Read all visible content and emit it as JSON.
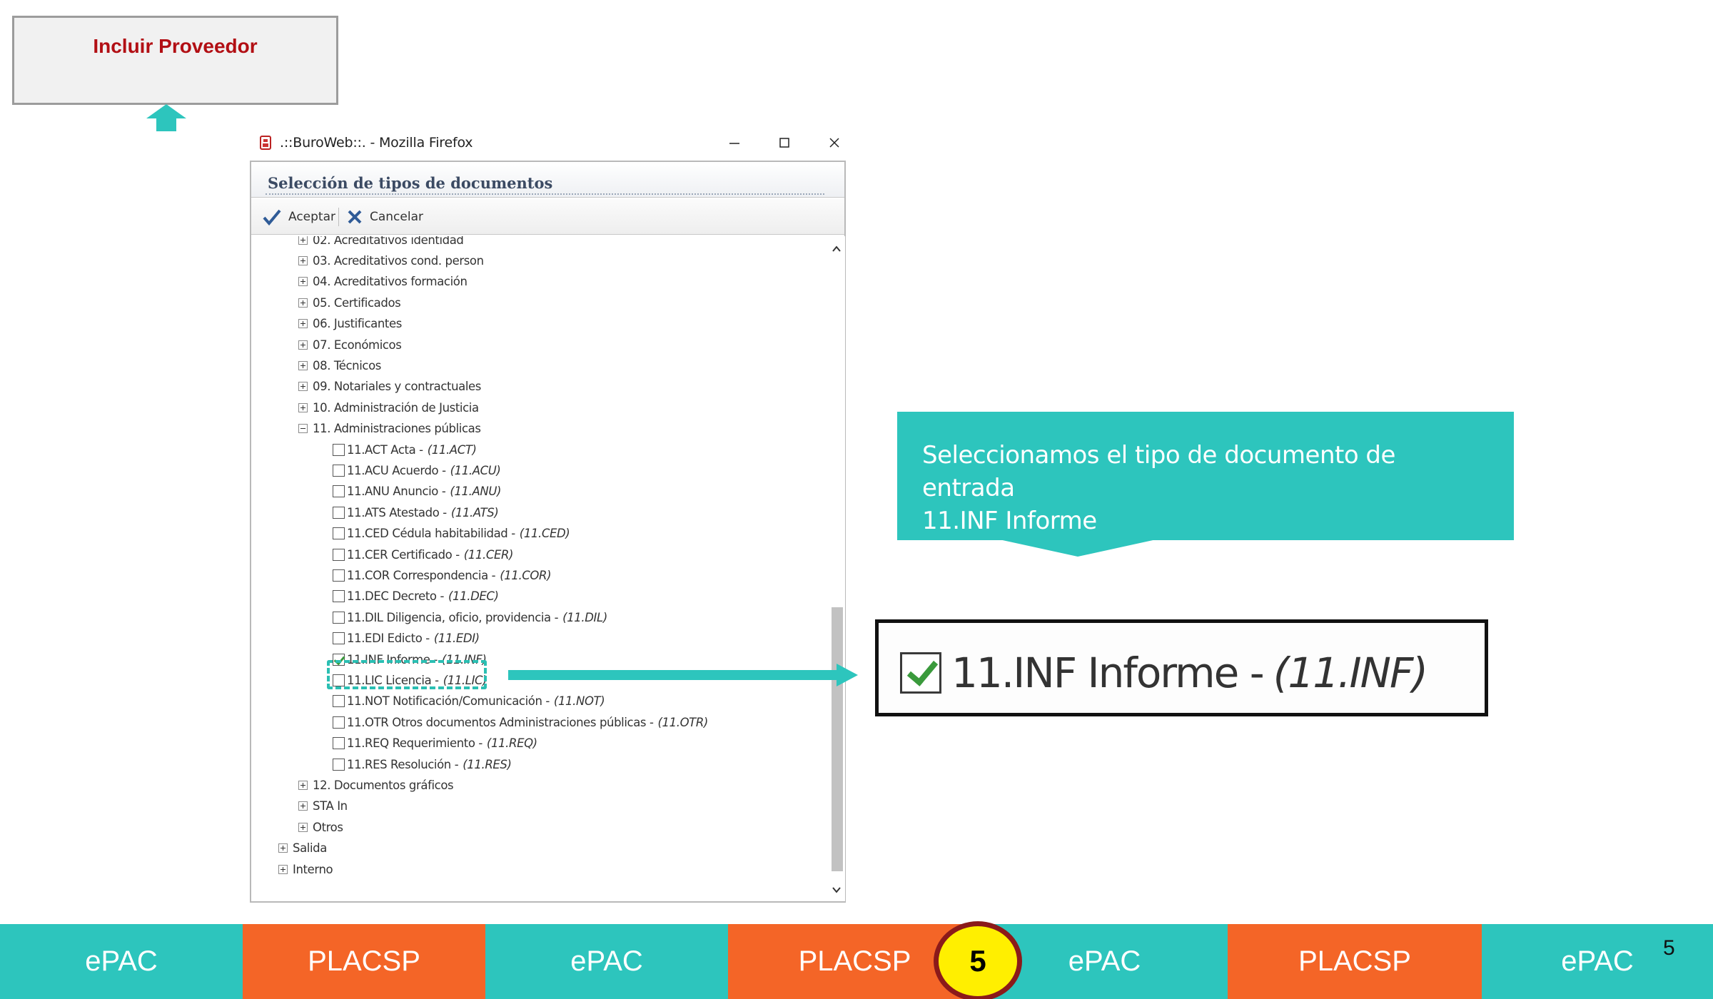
{
  "slide": {
    "provider_box_title": "Incluir Proveedor",
    "page_number": "5",
    "badge_number": "5"
  },
  "window": {
    "title": ".::BuroWeb::. - Mozilla Firefox"
  },
  "dialog": {
    "title": "Selección de tipos de documentos",
    "accept_label": "Aceptar",
    "cancel_label": "Cancelar"
  },
  "tree": {
    "items": [
      {
        "label": "02. Acreditativos identidad",
        "level": 1,
        "kind": "expander",
        "state": "plus"
      },
      {
        "label": "03. Acreditativos cond. person",
        "level": 1,
        "kind": "expander",
        "state": "plus"
      },
      {
        "label": "04. Acreditativos formación",
        "level": 1,
        "kind": "expander",
        "state": "plus"
      },
      {
        "label": "05. Certificados",
        "level": 1,
        "kind": "expander",
        "state": "plus"
      },
      {
        "label": "06. Justificantes",
        "level": 1,
        "kind": "expander",
        "state": "plus"
      },
      {
        "label": "07. Económicos",
        "level": 1,
        "kind": "expander",
        "state": "plus"
      },
      {
        "label": "08. Técnicos",
        "level": 1,
        "kind": "expander",
        "state": "plus"
      },
      {
        "label": "09. Notariales y contractuales",
        "level": 1,
        "kind": "expander",
        "state": "plus"
      },
      {
        "label": "10. Administración de Justicia",
        "level": 1,
        "kind": "expander",
        "state": "plus"
      },
      {
        "label": "11. Administraciones públicas",
        "level": 1,
        "kind": "expander",
        "state": "minus"
      },
      {
        "label": "11.ACT Acta -",
        "code": "(11.ACT)",
        "level": 2,
        "kind": "check",
        "checked": false
      },
      {
        "label": "11.ACU Acuerdo -",
        "code": "(11.ACU)",
        "level": 2,
        "kind": "check",
        "checked": false
      },
      {
        "label": "11.ANU Anuncio -",
        "code": "(11.ANU)",
        "level": 2,
        "kind": "check",
        "checked": false
      },
      {
        "label": "11.ATS Atestado -",
        "code": "(11.ATS)",
        "level": 2,
        "kind": "check",
        "checked": false
      },
      {
        "label": "11.CED Cédula habitabilidad -",
        "code": "(11.CED)",
        "level": 2,
        "kind": "check",
        "checked": false
      },
      {
        "label": "11.CER Certificado -",
        "code": "(11.CER)",
        "level": 2,
        "kind": "check",
        "checked": false
      },
      {
        "label": "11.COR Correspondencia -",
        "code": "(11.COR)",
        "level": 2,
        "kind": "check",
        "checked": false
      },
      {
        "label": "11.DEC Decreto -",
        "code": "(11.DEC)",
        "level": 2,
        "kind": "check",
        "checked": false
      },
      {
        "label": "11.DIL Diligencia, oficio, providencia -",
        "code": "(11.DIL)",
        "level": 2,
        "kind": "check",
        "checked": false
      },
      {
        "label": "11.EDI Edicto -",
        "code": "(11.EDI)",
        "level": 2,
        "kind": "check",
        "checked": false
      },
      {
        "label": "11.INF Informe -",
        "code": "(11.INF)",
        "level": 2,
        "kind": "check",
        "checked": true
      },
      {
        "label": "11.LIC Licencia -",
        "code": "(11.LIC)",
        "level": 2,
        "kind": "check",
        "checked": false
      },
      {
        "label": "11.NOT Notificación/Comunicación -",
        "code": "(11.NOT)",
        "level": 2,
        "kind": "check",
        "checked": false
      },
      {
        "label": "11.OTR Otros documentos Administraciones públicas -",
        "code": "(11.OTR)",
        "level": 2,
        "kind": "check",
        "checked": false
      },
      {
        "label": "11.REQ Requerimiento -",
        "code": "(11.REQ)",
        "level": 2,
        "kind": "check",
        "checked": false
      },
      {
        "label": "11.RES Resolución -",
        "code": "(11.RES)",
        "level": 2,
        "kind": "check",
        "checked": false
      },
      {
        "label": "12. Documentos gráficos",
        "level": 1,
        "kind": "expander",
        "state": "plus"
      },
      {
        "label": "STA In",
        "level": 1,
        "kind": "expander",
        "state": "plus"
      },
      {
        "label": "Otros",
        "level": 1,
        "kind": "expander",
        "state": "plus"
      },
      {
        "label": "Salida",
        "level": 0,
        "kind": "expander",
        "state": "plus"
      },
      {
        "label": "Interno",
        "level": 0,
        "kind": "expander",
        "state": "plus"
      }
    ]
  },
  "callout": {
    "line1": "Seleccionamos el tipo de documento de entrada",
    "line2": "11.INF Informe"
  },
  "zoom": {
    "label": "11.INF Informe -",
    "code": "(11.INF)"
  },
  "footer": {
    "segments": [
      "ePAC",
      "PLACSP",
      "ePAC",
      "PLACSP",
      "ePAC",
      "PLACSP",
      "ePAC"
    ]
  },
  "colors": {
    "teal": "#2dc5bd",
    "orange": "#f46527",
    "provider_title": "#b20f14",
    "badge_fill": "#ffef00",
    "badge_border": "#8b1a1a",
    "check_green": "#3a9a3c"
  }
}
